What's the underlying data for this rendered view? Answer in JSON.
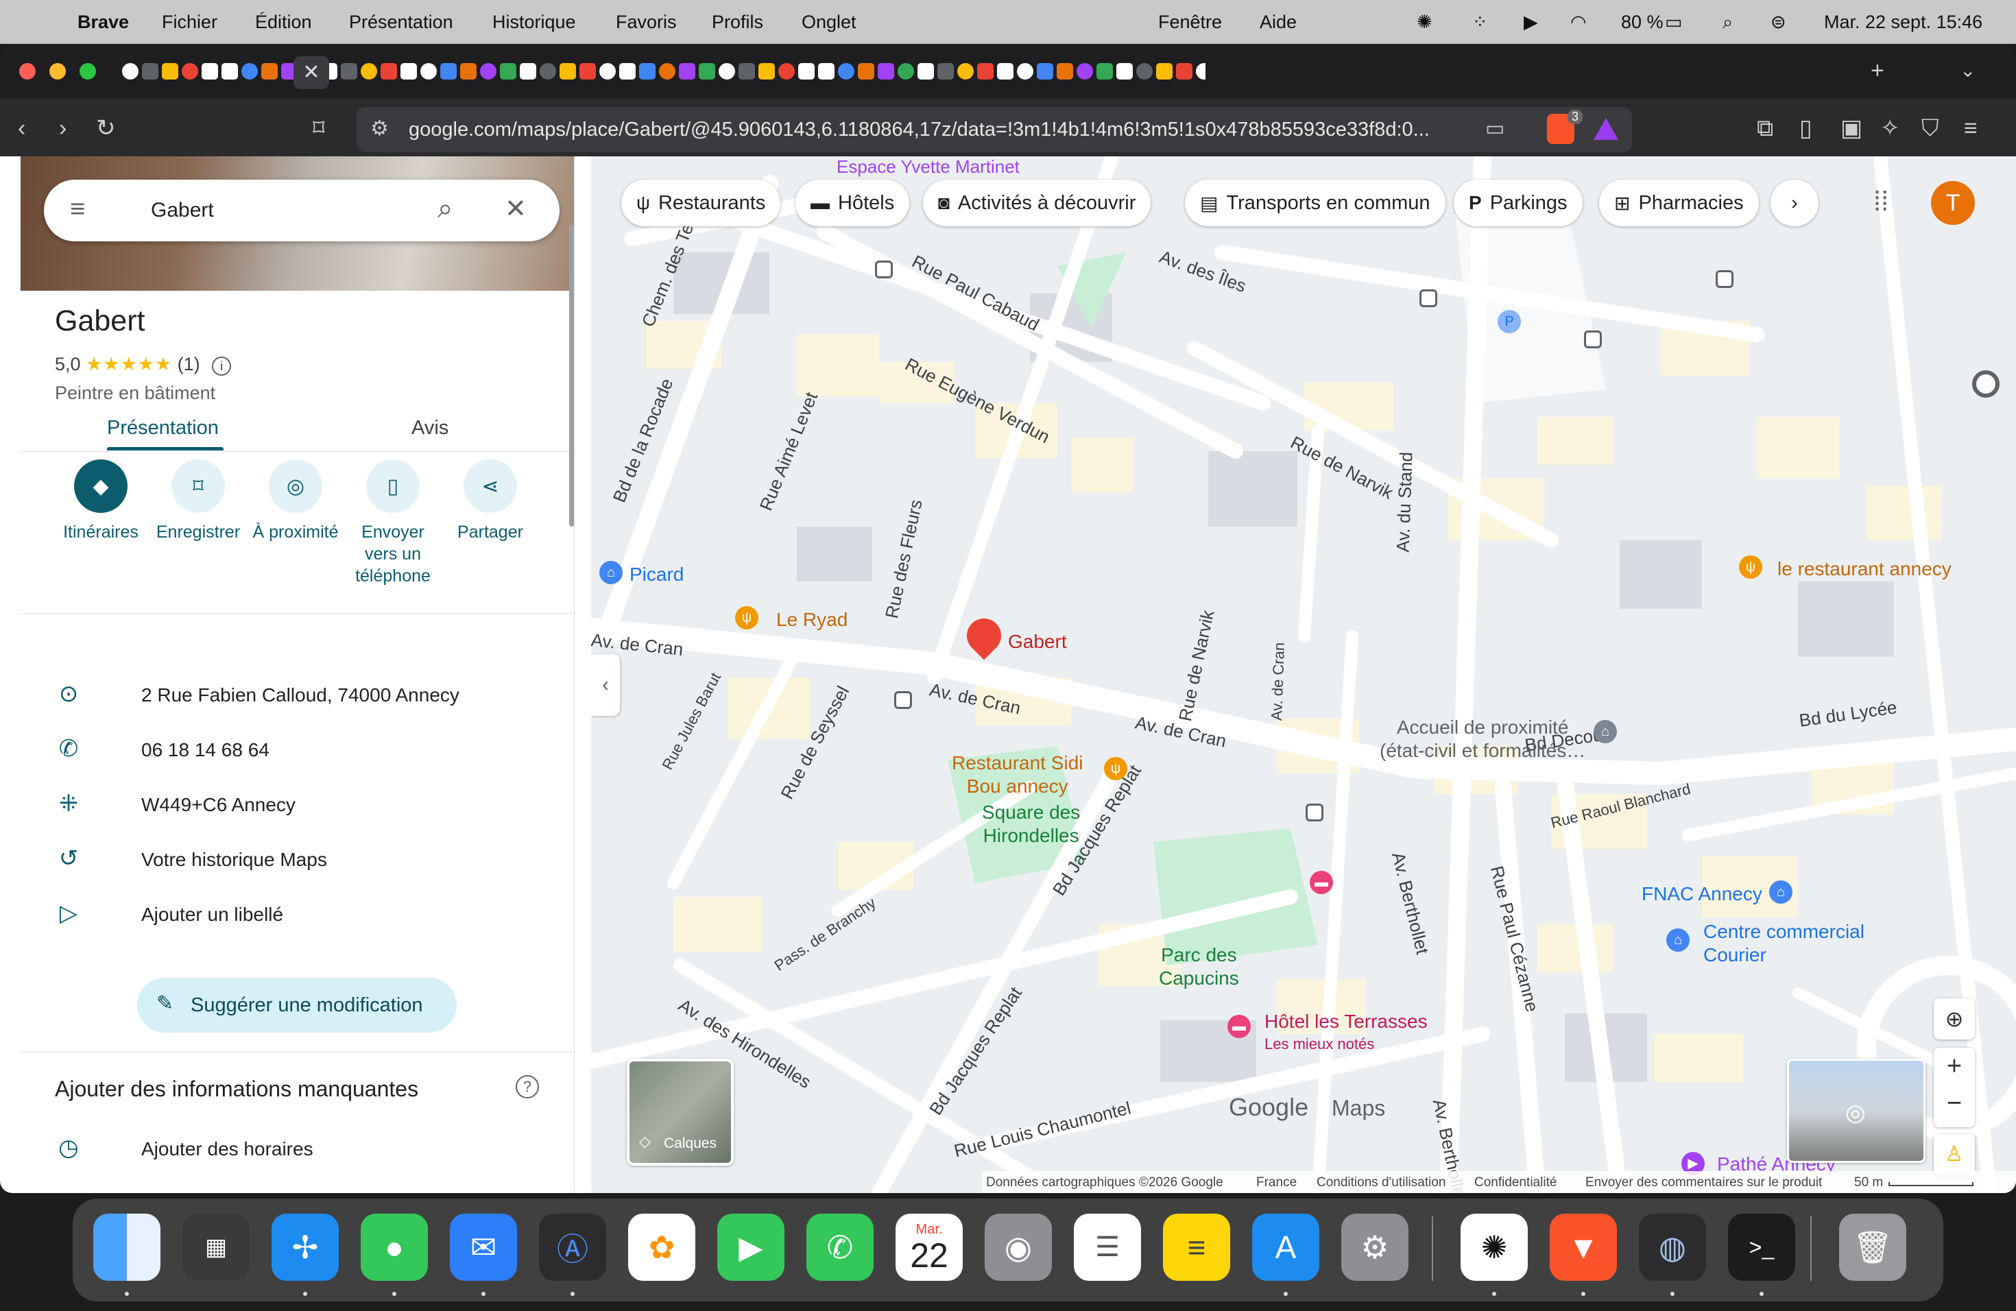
{
  "menubar": {
    "app": "Brave",
    "items": [
      "Fichier",
      "Édition",
      "Présentation",
      "Historique",
      "Favoris",
      "Profils",
      "Onglet"
    ],
    "right_items": [
      "Fenêtre",
      "Aide"
    ],
    "battery": "80 %",
    "clock": "Mar. 22 sept.  15:46"
  },
  "browser": {
    "url": "google.com/maps/place/Gabert/@45.9060143,6.1180864,17z/data=!3m1!4b1!4m6!3m5!1s0x478b85593ce33f8d:0...",
    "brave_badge": "3"
  },
  "panel": {
    "search_value": "Gabert",
    "title": "Gabert",
    "rating_value": "5,0",
    "stars": "★★★★★",
    "rating_count": "(1)",
    "category": "Peintre en bâtiment",
    "tabs": [
      "Présentation",
      "Avis"
    ],
    "actions": [
      {
        "label": "Itinéraires"
      },
      {
        "label": "Enregistrer"
      },
      {
        "label": "À proximité"
      },
      {
        "label": "Envoyer\nvers un\ntéléphone"
      },
      {
        "label": "Partager"
      }
    ],
    "address": "2 Rue Fabien Calloud, 74000 Annecy",
    "phone": "06 18 14 68 64",
    "pluscode": "W449+C6 Annecy",
    "history": "Votre historique Maps",
    "add_label": "Ajouter un libellé",
    "suggest": "Suggérer une modification",
    "missing_title": "Ajouter des informations manquantes",
    "add_hours": "Ajouter des horaires"
  },
  "map": {
    "chips": [
      "Restaurants",
      "Hôtels",
      "Activités à découvrir",
      "Transports en commun",
      "Parkings",
      "Pharmacies"
    ],
    "avatar": "T",
    "streets": [
      {
        "text": "Espace Yvette Martinet"
      },
      {
        "text": "Rue Paul Cabaud"
      },
      {
        "text": "Av. des Îles"
      },
      {
        "text": "Chem. des Te"
      },
      {
        "text": "Rue Eugène Verdun"
      },
      {
        "text": "Bd de la Rocade"
      },
      {
        "text": "Rue de Narvik"
      },
      {
        "text": "Rue Aimé Levet"
      },
      {
        "text": "Av. du Stand"
      },
      {
        "text": "Rue des Fleurs"
      },
      {
        "text": "Av. de Cran"
      },
      {
        "text": "Av. de Cran"
      },
      {
        "text": "Av. de Cran"
      },
      {
        "text": "Rue de Narvik"
      },
      {
        "text": "Av. de Cran"
      },
      {
        "text": "Rue Jules Barut"
      },
      {
        "text": "Rue de Seyssel"
      },
      {
        "text": "Bd Decouz"
      },
      {
        "text": "Bd du Lycée"
      },
      {
        "text": "Rue Raoul Blanchard"
      },
      {
        "text": "Av. Berthollet"
      },
      {
        "text": "Rue Paul Cézanne"
      },
      {
        "text": "Bd Jacques Replat"
      },
      {
        "text": "Pass. de Branchy"
      },
      {
        "text": "Av. des Hirondelles"
      },
      {
        "text": "Bd Jacques Replat"
      },
      {
        "text": "Av. Berthollet"
      },
      {
        "text": "Rue Louis Chaumontel"
      }
    ],
    "pois": {
      "picard": "Picard",
      "le_ryad": "Le Ryad",
      "gabert": "Gabert",
      "restaurant_annecy": "le restaurant annecy",
      "accueil": "Accueil de proximité\n(état-civil et formalités…",
      "sidi_bou": "Restaurant Sidi\nBou annecy",
      "square": "Square des\nHirondelles",
      "parc": "Parc des\nCapucins",
      "fnac": "FNAC Annecy",
      "centre": "Centre commercial\nCourier",
      "hotel": "Hôtel les Terrasses",
      "hotel_sub": "Les mieux notés",
      "pathe": "Pathé Annecy"
    },
    "layers": "Calques",
    "google_logo": "Google",
    "maps_word": "Maps",
    "footer": [
      "Données cartographiques ©2026 Google",
      "France",
      "Conditions d'utilisation",
      "Confidentialité",
      "Envoyer des commentaires sur le produit",
      "50 m"
    ]
  },
  "dock": {
    "calendar_month": "Mar.",
    "calendar_day": "22"
  }
}
